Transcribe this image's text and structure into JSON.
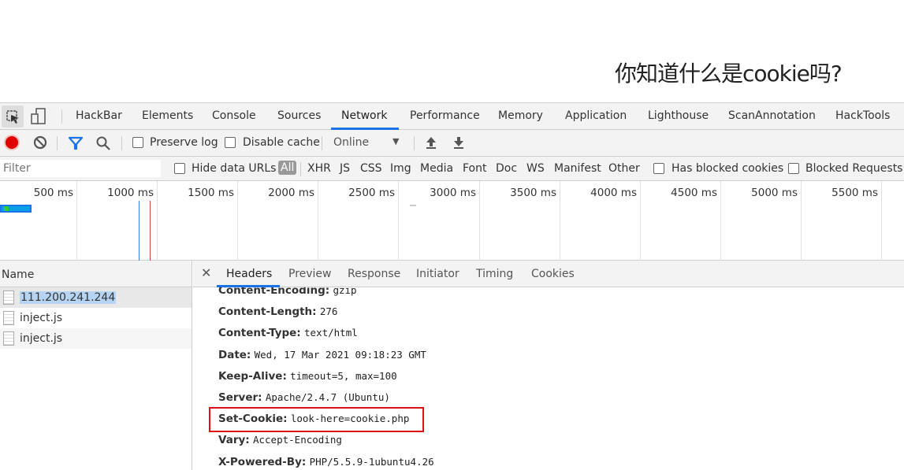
{
  "page": {
    "heading": "你知道什么是cookie吗?"
  },
  "devtools": {
    "tabs": [
      "HackBar",
      "Elements",
      "Console",
      "Sources",
      "Network",
      "Performance",
      "Memory",
      "Application",
      "Lighthouse",
      "ScanAnnotation",
      "HackTools"
    ],
    "active_tab": "Network",
    "accent": "#1a73e8"
  },
  "toolbar": {
    "preserve_log": "Preserve log",
    "disable_cache": "Disable cache",
    "throttle": "Online",
    "record_color": "#e00000"
  },
  "filterbar": {
    "placeholder": "Filter",
    "hide_data_urls": "Hide data URLs",
    "types": [
      "All",
      "XHR",
      "JS",
      "CSS",
      "Img",
      "Media",
      "Font",
      "Doc",
      "WS",
      "Manifest",
      "Other"
    ],
    "has_blocked_cookies": "Has blocked cookies",
    "blocked_requests": "Blocked Requests"
  },
  "timeline": {
    "ticks": [
      "500 ms",
      "1000 ms",
      "1500 ms",
      "2000 ms",
      "2500 ms",
      "3000 ms",
      "3500 ms",
      "4000 ms",
      "4500 ms",
      "5000 ms",
      "5500 ms"
    ]
  },
  "requests": {
    "header": "Name",
    "items": [
      "111.200.241.244",
      "inject.js",
      "inject.js"
    ]
  },
  "detail": {
    "tabs": [
      "Headers",
      "Preview",
      "Response",
      "Initiator",
      "Timing",
      "Cookies"
    ],
    "active_tab": "Headers",
    "headers": [
      {
        "k": "Content-Encoding:",
        "v": "gzip"
      },
      {
        "k": "Content-Length:",
        "v": "276"
      },
      {
        "k": "Content-Type:",
        "v": "text/html"
      },
      {
        "k": "Date:",
        "v": "Wed, 17 Mar 2021 09:18:23 GMT"
      },
      {
        "k": "Keep-Alive:",
        "v": "timeout=5, max=100"
      },
      {
        "k": "Server:",
        "v": "Apache/2.4.7 (Ubuntu)"
      },
      {
        "k": "Set-Cookie:",
        "v": "look-here=cookie.php"
      },
      {
        "k": "Vary:",
        "v": "Accept-Encoding"
      },
      {
        "k": "X-Powered-By:",
        "v": "PHP/5.5.9-1ubuntu4.26"
      }
    ],
    "highlight_color": "#e0101a"
  }
}
